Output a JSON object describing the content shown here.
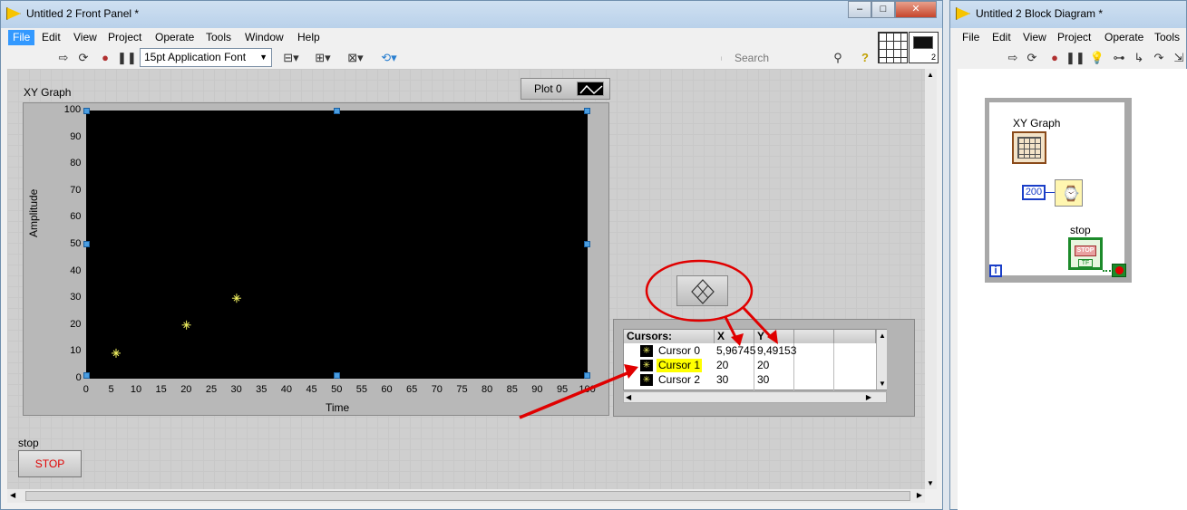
{
  "front_panel": {
    "title": "Untitled 2 Front Panel *",
    "menu": [
      "File",
      "Edit",
      "View",
      "Project",
      "Operate",
      "Tools",
      "Window",
      "Help"
    ],
    "font": "15pt Application Font",
    "search_placeholder": "Search",
    "window_buttons": [
      "–",
      "□",
      "✕"
    ],
    "graph": {
      "label": "XY Graph",
      "legend_label": "Plot 0",
      "xlabel": "Time",
      "ylabel": "Amplitude",
      "x_ticks": [
        "0",
        "5",
        "10",
        "15",
        "20",
        "25",
        "30",
        "35",
        "40",
        "45",
        "50",
        "55",
        "60",
        "65",
        "70",
        "75",
        "80",
        "85",
        "90",
        "95",
        "100"
      ],
      "y_ticks": [
        "100",
        "90",
        "80",
        "70",
        "60",
        "50",
        "40",
        "30",
        "20",
        "10",
        "0"
      ]
    },
    "cursors": {
      "header": "Cursors:",
      "col_x": "X",
      "col_y": "Y",
      "rows": [
        {
          "name": "Cursor 0",
          "x": "5,96745",
          "y": "9,49153"
        },
        {
          "name": "Cursor 1",
          "x": "20",
          "y": "20"
        },
        {
          "name": "Cursor 2",
          "x": "30",
          "y": "30"
        }
      ]
    },
    "stop_label": "stop",
    "stop_button": "STOP"
  },
  "chart_data": {
    "type": "scatter",
    "xlabel": "Time",
    "ylabel": "Amplitude",
    "xlim": [
      0,
      100
    ],
    "ylim": [
      0,
      100
    ],
    "series": [
      {
        "name": "Plot 0",
        "points": [
          [
            5.96745,
            9.49153
          ],
          [
            20,
            20
          ],
          [
            30,
            30
          ]
        ]
      }
    ],
    "grid": false
  },
  "block_diagram": {
    "title": "Untitled 2 Block Diagram *",
    "menu": [
      "File",
      "Edit",
      "View",
      "Project",
      "Operate",
      "Tools"
    ],
    "graph_label": "XY Graph",
    "wait_const": "200",
    "stop_label": "stop",
    "stop_icon_text": "STOP",
    "tf_text": "TF",
    "iter_label": "i"
  },
  "colors": {
    "accent": "#3399ff",
    "annotation": "#e00000",
    "cursor": "#f0f060",
    "plot_bg": "#000000"
  }
}
